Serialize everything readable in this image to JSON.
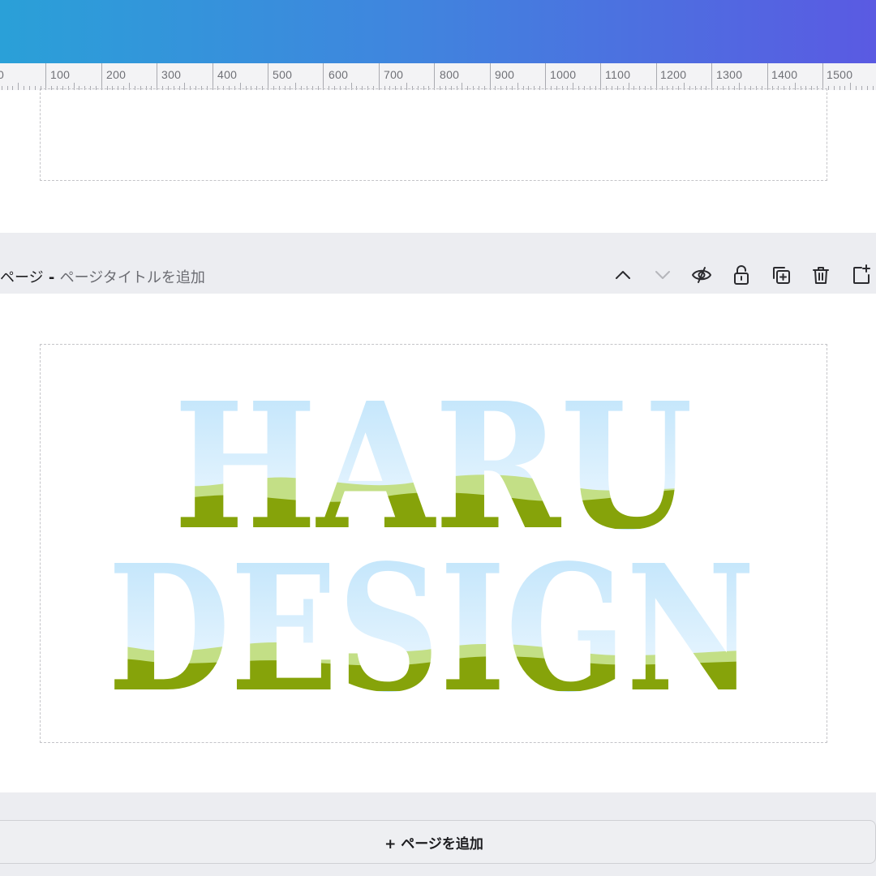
{
  "ruler": {
    "labels": [
      "0",
      "100",
      "200",
      "300",
      "400",
      "500",
      "600",
      "700",
      "800",
      "900",
      "1000",
      "1100",
      "1200",
      "1300",
      "1400",
      "1500"
    ]
  },
  "page_header": {
    "page_label": "ページ",
    "separator": " - ",
    "title_placeholder": "ページタイトルを追加"
  },
  "toolbar_icons": [
    "chevron-up-icon",
    "chevron-down-icon",
    "eye-slash-icon",
    "unlock-icon",
    "duplicate-icon",
    "trash-icon",
    "add-page-icon"
  ],
  "design": {
    "line1": "HARU",
    "line2": "DESIGN",
    "colors": {
      "sky_top": "#c4e6fb",
      "sky_bottom": "#eef8ff",
      "hill_light": "#c3df86",
      "hill_dark": "#86a30a"
    }
  },
  "add_page_button": "+ ページを追加"
}
